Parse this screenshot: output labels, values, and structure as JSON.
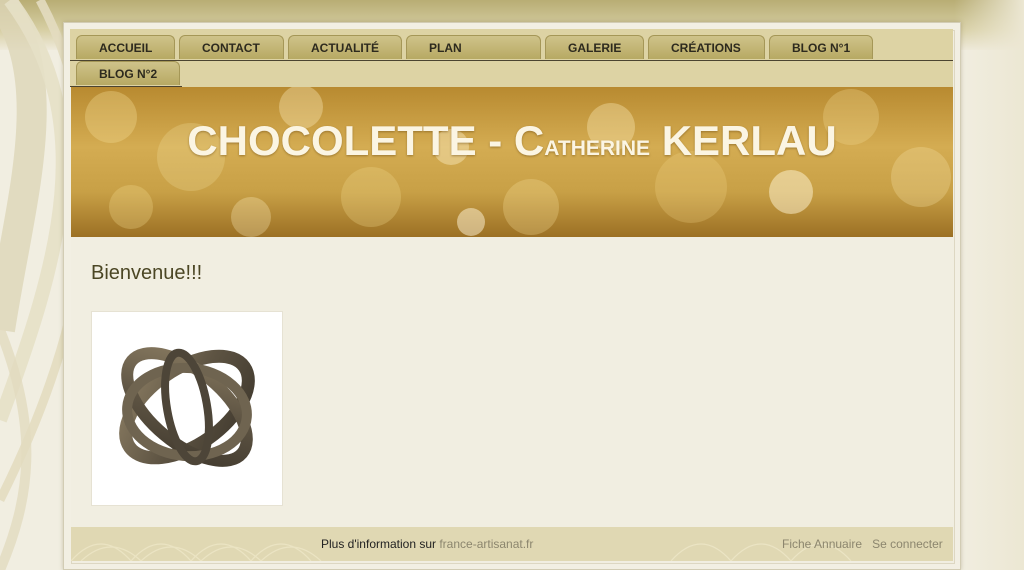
{
  "nav": {
    "items": [
      {
        "label": "ACCUEIL"
      },
      {
        "label": "CONTACT"
      },
      {
        "label": "ACTUALITÉ"
      },
      {
        "label": "PLAN"
      },
      {
        "label": "GALERIE"
      },
      {
        "label": "CRÉATIONS"
      },
      {
        "label": "BLOG N°1"
      },
      {
        "label": "BLOG N°2"
      }
    ]
  },
  "header": {
    "title_part1": "CHOCOLETTE - C",
    "title_part2": "atherine",
    "title_part3": " KERLAU"
  },
  "main": {
    "welcome": "Bienvenue!!!"
  },
  "footer": {
    "info_prefix": "Plus d'information sur ",
    "info_link": "france-artisanat.fr",
    "fiche": "Fiche Annuaire",
    "login": "Se connecter"
  },
  "colors": {
    "gold_accent": "#c9a24b",
    "tab_fill": "#c4b775",
    "title_text": "#fbf5e3",
    "welcome_text": "#4b4624"
  },
  "icons": {
    "photo": "bronze-knot-sculpture-image"
  }
}
